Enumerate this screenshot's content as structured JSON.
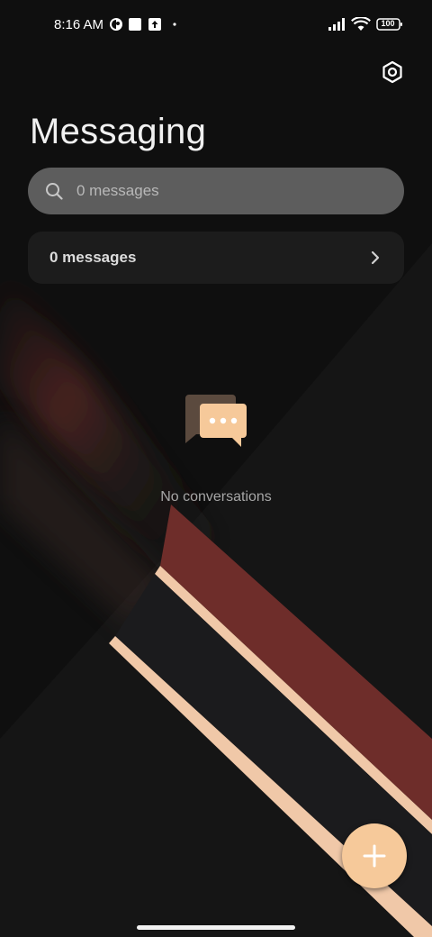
{
  "status_bar": {
    "time": "8:16 AM",
    "battery_level": "100",
    "icons": [
      "brand-notification-icon",
      "square-notification-icon",
      "upload-notification-icon",
      "dot-icon",
      "signal-icon",
      "wifi-icon",
      "battery-icon"
    ]
  },
  "header": {
    "title": "Messaging",
    "settings_icon": "settings-icon"
  },
  "search": {
    "placeholder": "0 messages",
    "icon": "search-icon"
  },
  "message_summary": {
    "label": "0 messages",
    "icon": "chevron-right-icon"
  },
  "empty_state": {
    "text": "No conversations",
    "icon": "chat-bubbles-icon"
  },
  "fab": {
    "icon": "plus-icon"
  },
  "colors": {
    "accent": "#f6c99a",
    "background": "#0e0e0e",
    "search_bg": "#5d5d5d",
    "row_bg": "#1c1c1c",
    "wallpaper_red": "#6e2d2a"
  }
}
